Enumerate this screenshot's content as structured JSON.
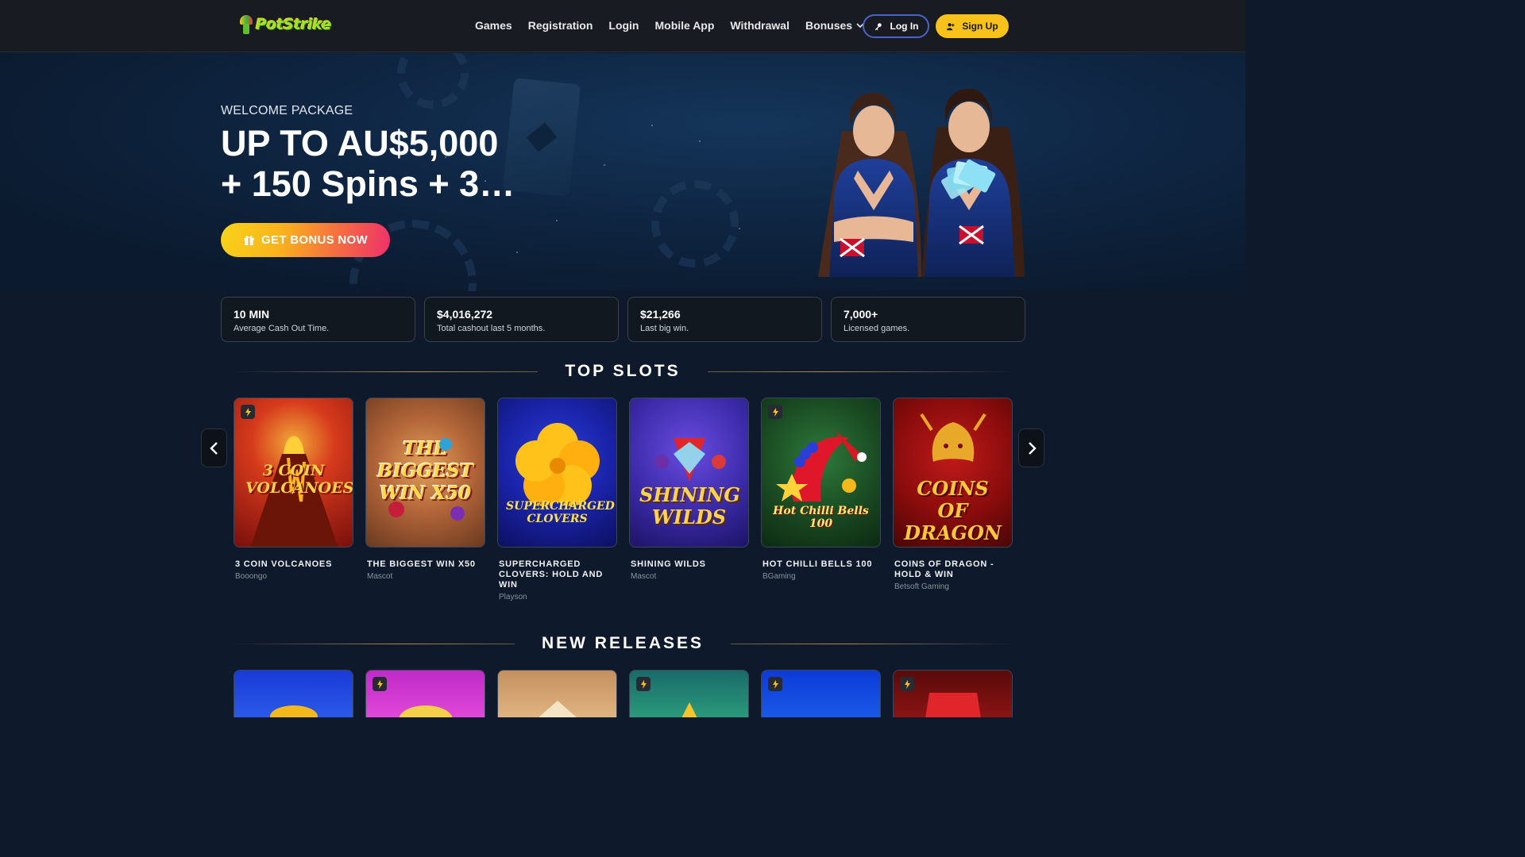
{
  "header": {
    "logo_text": "PotStrike",
    "nav": [
      {
        "label": "Games"
      },
      {
        "label": "Registration"
      },
      {
        "label": "Login"
      },
      {
        "label": "Mobile App"
      },
      {
        "label": "Withdrawal"
      },
      {
        "label": "Bonuses"
      }
    ],
    "login_label": "Log In",
    "signup_label": "Sign Up"
  },
  "hero": {
    "kicker": "WELCOME PACKAGE",
    "title_line1": "UP TO AU$5,000",
    "title_line2": "+ 150 Spins + 3…",
    "cta_label": "GET BONUS NOW"
  },
  "stats": [
    {
      "value": "10 MIN",
      "label": "Average Cash Out Time."
    },
    {
      "value": "$4,016,272",
      "label": "Total cashout last 5 months."
    },
    {
      "value": "$21,266",
      "label": "Last big win."
    },
    {
      "value": "7,000+",
      "label": "Licensed games."
    }
  ],
  "top_slots": {
    "title": "TOP SLOTS",
    "items": [
      {
        "name": "3 COIN VOLCANOES",
        "provider": "Booongo",
        "art": "3 COIN VOLCANOES",
        "bolt": true
      },
      {
        "name": "THE BIGGEST WIN X50",
        "provider": "Mascot",
        "art": "THE BIGGEST WIN X50",
        "bolt": false
      },
      {
        "name": "SUPERCHARGED CLOVERS: HOLD AND WIN",
        "provider": "Playson",
        "art": "SUPERCHARGED CLOVERS",
        "bolt": false
      },
      {
        "name": "SHINING WILDS",
        "provider": "Mascot",
        "art": "SHINING WILDS",
        "bolt": false
      },
      {
        "name": "HOT CHILLI BELLS 100",
        "provider": "BGaming",
        "art": "Hot Chilli Bells 100",
        "bolt": true
      },
      {
        "name": "COINS OF DRAGON - HOLD & WIN",
        "provider": "Betsoft Gaming",
        "art": "COINS OF DRAGON",
        "bolt": false
      }
    ]
  },
  "new_releases": {
    "title": "NEW RELEASES"
  },
  "colors": {
    "accent_yellow": "#f9c21a",
    "accent_blue": "#4a62c9",
    "background": "#0e1a2b"
  }
}
